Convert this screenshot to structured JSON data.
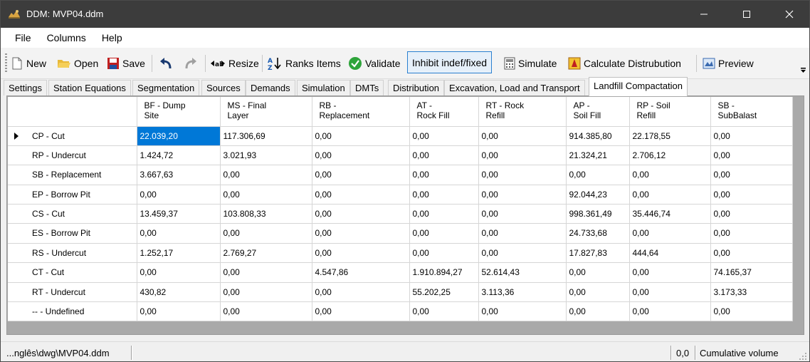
{
  "window": {
    "title": "DDM: MVP04.ddm"
  },
  "menu": [
    "File",
    "Columns",
    "Help"
  ],
  "toolbar": {
    "new": "New",
    "open": "Open",
    "save": "Save",
    "resize": "Resize",
    "ranks_items": "Ranks Items",
    "validate": "Validate",
    "inhibit": "Inhibit indef/fixed",
    "simulate": "Simulate",
    "calculate": "Calculate Distrubution",
    "preview": "Preview"
  },
  "tabs": [
    "Settings",
    "Station Equations",
    "Segmentation",
    "Sources",
    "Demands",
    "Simulation",
    "DMTs",
    "Distribution",
    "Excavation, Load and Transport",
    "Landfill Compactation"
  ],
  "active_tab": "Landfill Compactation",
  "grid": {
    "columns": [
      [
        "BF - Dump",
        "Site"
      ],
      [
        "MS - Final",
        "Layer"
      ],
      [
        "RB -",
        "Replacement"
      ],
      [
        "AT -",
        "Rock Fill"
      ],
      [
        "RT - Rock",
        "Refill"
      ],
      [
        "AP -",
        "Soil Fill"
      ],
      [
        "RP - Soil",
        "Refill"
      ],
      [
        "SB -",
        "SubBalast"
      ]
    ],
    "rows": [
      {
        "label": "CP - Cut",
        "values": [
          "22.039,20",
          "117.306,69",
          "0,00",
          "0,00",
          "0,00",
          "914.385,80",
          "22.178,55",
          "0,00"
        ]
      },
      {
        "label": "RP - Undercut",
        "values": [
          "1.424,72",
          "3.021,93",
          "0,00",
          "0,00",
          "0,00",
          "21.324,21",
          "2.706,12",
          "0,00"
        ]
      },
      {
        "label": "SB - Replacement",
        "values": [
          "3.667,63",
          "0,00",
          "0,00",
          "0,00",
          "0,00",
          "0,00",
          "0,00",
          "0,00"
        ]
      },
      {
        "label": "EP - Borrow Pit",
        "values": [
          "0,00",
          "0,00",
          "0,00",
          "0,00",
          "0,00",
          "92.044,23",
          "0,00",
          "0,00"
        ]
      },
      {
        "label": "CS - Cut",
        "values": [
          "13.459,37",
          "103.808,33",
          "0,00",
          "0,00",
          "0,00",
          "998.361,49",
          "35.446,74",
          "0,00"
        ]
      },
      {
        "label": "ES - Borrow Pit",
        "values": [
          "0,00",
          "0,00",
          "0,00",
          "0,00",
          "0,00",
          "24.733,68",
          "0,00",
          "0,00"
        ]
      },
      {
        "label": "RS - Undercut",
        "values": [
          "1.252,17",
          "2.769,27",
          "0,00",
          "0,00",
          "0,00",
          "17.827,83",
          "444,64",
          "0,00"
        ]
      },
      {
        "label": "CT - Cut",
        "values": [
          "0,00",
          "0,00",
          "4.547,86",
          "1.910.894,27",
          "52.614,43",
          "0,00",
          "0,00",
          "74.165,37"
        ]
      },
      {
        "label": "RT - Undercut",
        "values": [
          "430,82",
          "0,00",
          "0,00",
          "55.202,25",
          "3.113,36",
          "0,00",
          "0,00",
          "3.173,33"
        ]
      },
      {
        "label": "-- - Undefined",
        "values": [
          "0,00",
          "0,00",
          "0,00",
          "0,00",
          "0,00",
          "0,00",
          "0,00",
          "0,00"
        ]
      }
    ]
  },
  "status": {
    "path": "...nglês\\dwg\\MVP04.ddm",
    "value": "0,0",
    "label": "Cumulative volume"
  },
  "colors": {
    "titlebar": "#3c3c3c",
    "selection": "#0078d7",
    "panel_bg": "#a9a9a9"
  }
}
